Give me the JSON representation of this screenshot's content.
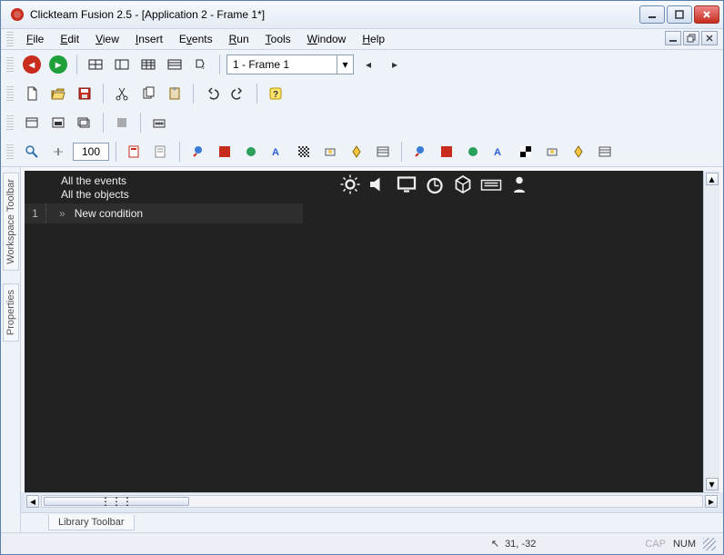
{
  "title": "Clickteam Fusion 2.5 - [Application 2 - Frame 1*]",
  "menu": [
    "File",
    "Edit",
    "View",
    "Insert",
    "Events",
    "Run",
    "Tools",
    "Window",
    "Help"
  ],
  "frame_selector": "1 - Frame 1",
  "zoom_value": "100",
  "side_tabs": {
    "workspace": "Workspace Toolbar",
    "properties": "Properties"
  },
  "events": {
    "header_line1": "All the events",
    "header_line2": "All the objects",
    "row_number": "1",
    "row_bullet": "»",
    "new_condition": "New condition",
    "object_icons": [
      "settings",
      "sound",
      "display",
      "time",
      "cube",
      "keyboard",
      "player"
    ]
  },
  "library_tab": "Library Toolbar",
  "status": {
    "coords": "31, -32",
    "cap": "CAP",
    "num": "NUM"
  }
}
